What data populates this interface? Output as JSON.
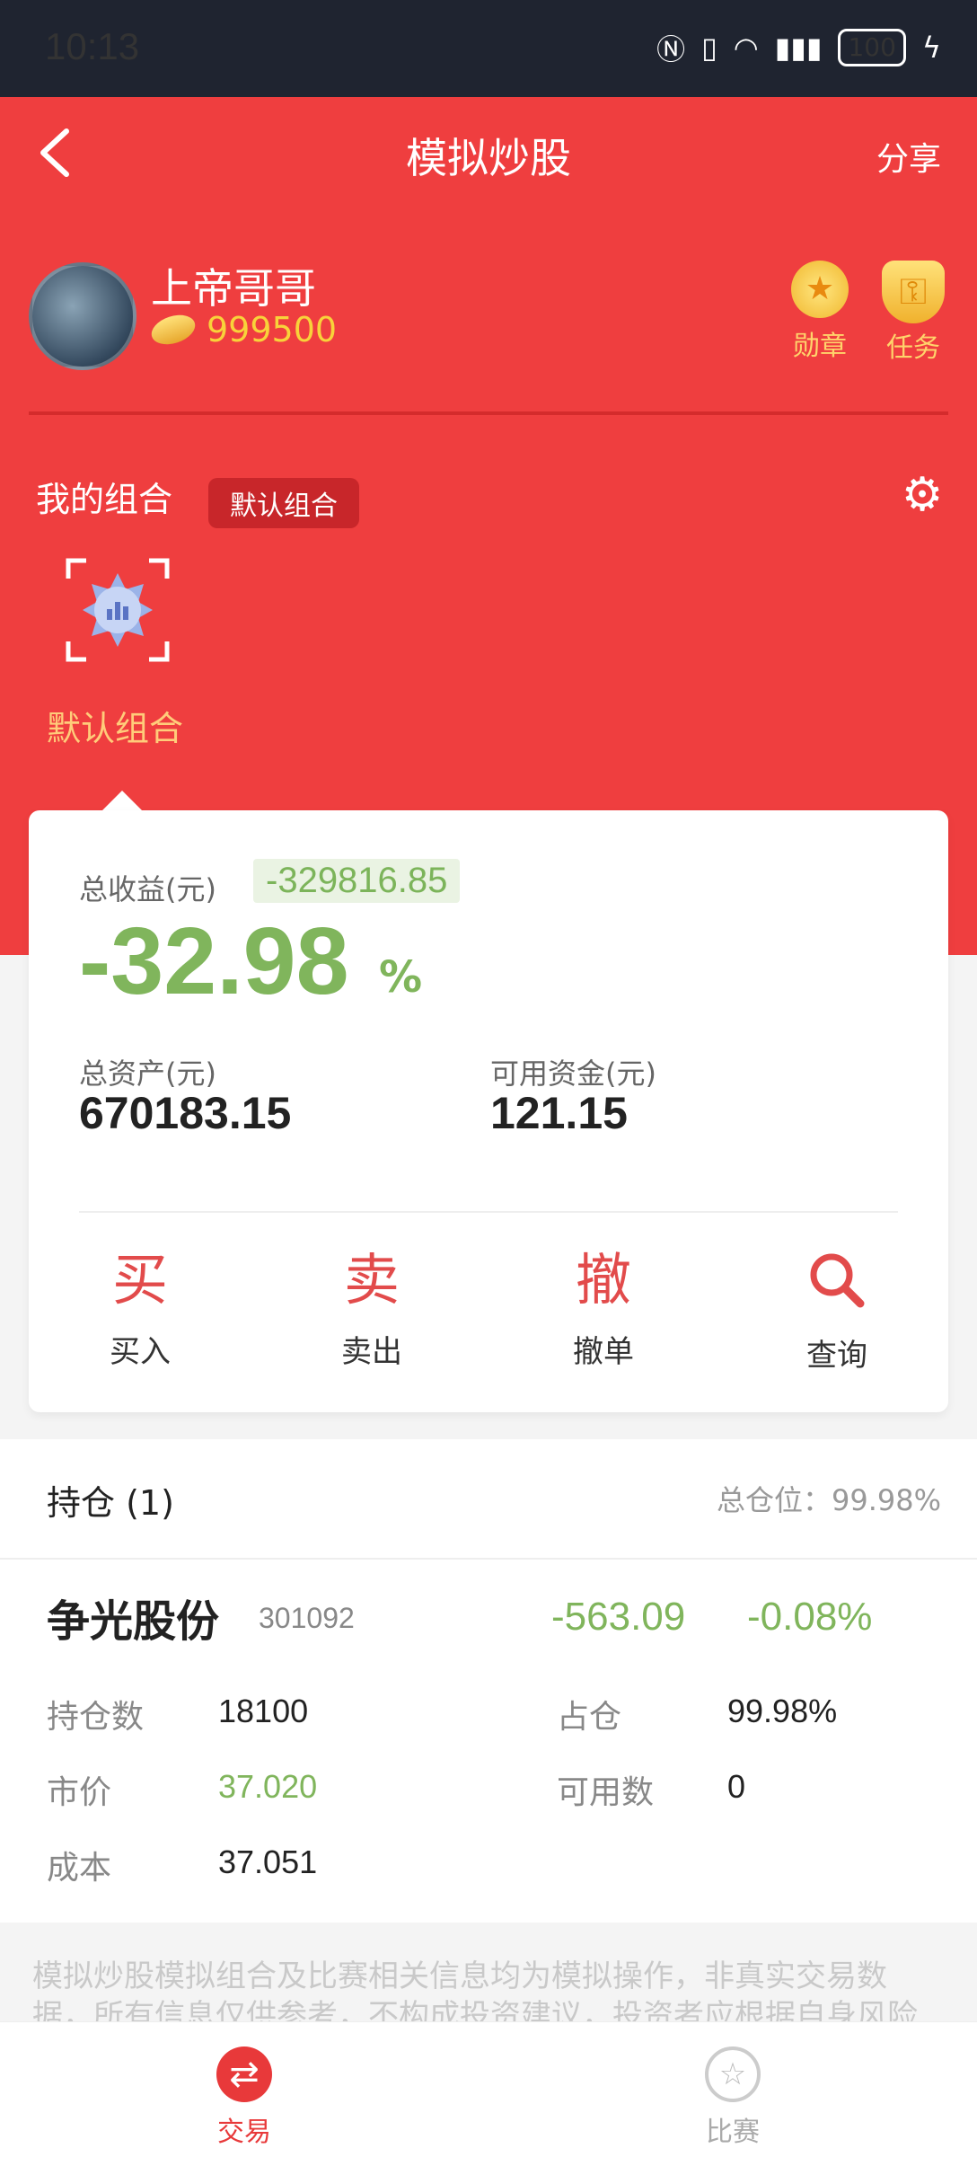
{
  "status_bar": {
    "time": "10:13",
    "battery": "100"
  },
  "header": {
    "title": "模拟炒股",
    "share_label": "分享"
  },
  "user": {
    "name": "上帝哥哥",
    "coins": "999500"
  },
  "badges": {
    "medal_label": "勋章",
    "task_label": "任务"
  },
  "portfolio": {
    "section_label": "我的组合",
    "tag": "默认组合",
    "combo_name": "默认组合"
  },
  "summary": {
    "profit_label": "总收益(元)",
    "profit_value": "-329816.85",
    "profit_pct": "-32.98",
    "pct_sign": "%",
    "assets_label": "总资产(元)",
    "assets_value": "670183.15",
    "cash_label": "可用资金(元)",
    "cash_value": "121.15"
  },
  "actions": [
    {
      "glyph": "买",
      "label": "买入"
    },
    {
      "glyph": "卖",
      "label": "卖出"
    },
    {
      "glyph": "撤",
      "label": "撤单"
    },
    {
      "icon": "search-icon",
      "label": "查询"
    }
  ],
  "holdings": {
    "title": "持仓 (1)",
    "total_position": "总仓位：99.98%",
    "stock": {
      "name": "争光股份",
      "code": "301092",
      "change": "-563.09",
      "change_pct": "-0.08%",
      "qty_label": "持仓数",
      "qty_value": "18100",
      "weight_label": "占仓",
      "weight_value": "99.98%",
      "price_label": "市价",
      "price_value": "37.020",
      "avail_label": "可用数",
      "avail_value": "0",
      "cost_label": "成本",
      "cost_value": "37.051"
    }
  },
  "disclaimer": "模拟炒股模拟组合及比赛相关信息均为模拟操作，非真实交易数据，所有信息仅供参考，不构成投资建议，投资者应根据自身风险",
  "tabbar": [
    {
      "label": "交易",
      "icon": "exchange-icon",
      "active": true
    },
    {
      "label": "比赛",
      "icon": "medal-icon",
      "active": false
    }
  ],
  "colors": {
    "brand_red": "#ef3e3f",
    "loss_green": "#80b55c",
    "coin_gold": "#f8d23a"
  }
}
